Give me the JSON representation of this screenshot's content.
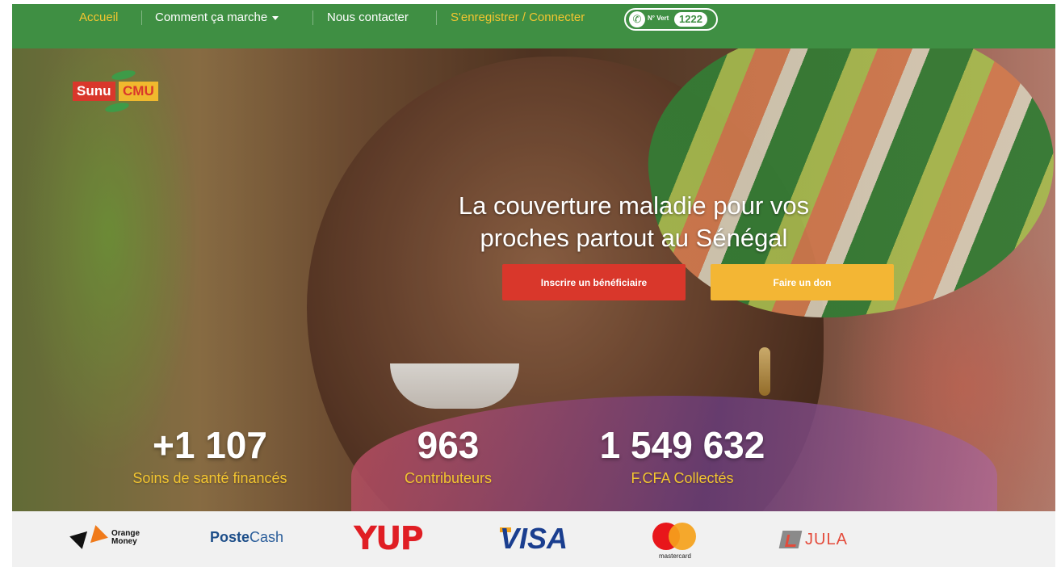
{
  "nav": {
    "items": [
      {
        "label": "Accueil"
      },
      {
        "label": "Comment ça marche"
      },
      {
        "label": "Nous contacter"
      },
      {
        "label": "S'enregistrer / Connecter"
      }
    ],
    "hotline": {
      "prefix": "N° Vert",
      "number": "1222"
    }
  },
  "logo": {
    "part1": "Sunu",
    "part2": "CMU"
  },
  "hero": {
    "headline_line1": "La couverture maladie pour vos",
    "headline_line2": "proches partout au Sénégal",
    "primary_button": "Inscrire un bénéficiaire",
    "secondary_button": "Faire un don"
  },
  "stats": [
    {
      "value": "+1 107",
      "label": "Soins de santé financés"
    },
    {
      "value": "963",
      "label": "Contributeurs"
    },
    {
      "value": "1 549 632",
      "label": "F.CFA Collectés"
    }
  ],
  "payments": {
    "orange_money": {
      "line1": "Orange",
      "line2": "Money"
    },
    "postecash": {
      "part1": "Poste",
      "part2": "Cash"
    },
    "yup": "YUP",
    "visa": "VISA",
    "mastercard": "mastercard",
    "jula": "JULA"
  },
  "colors": {
    "nav_green": "#3f8f43",
    "brand_red": "#d9372b",
    "brand_yellow": "#f3b634",
    "stat_label": "#f3c530"
  }
}
